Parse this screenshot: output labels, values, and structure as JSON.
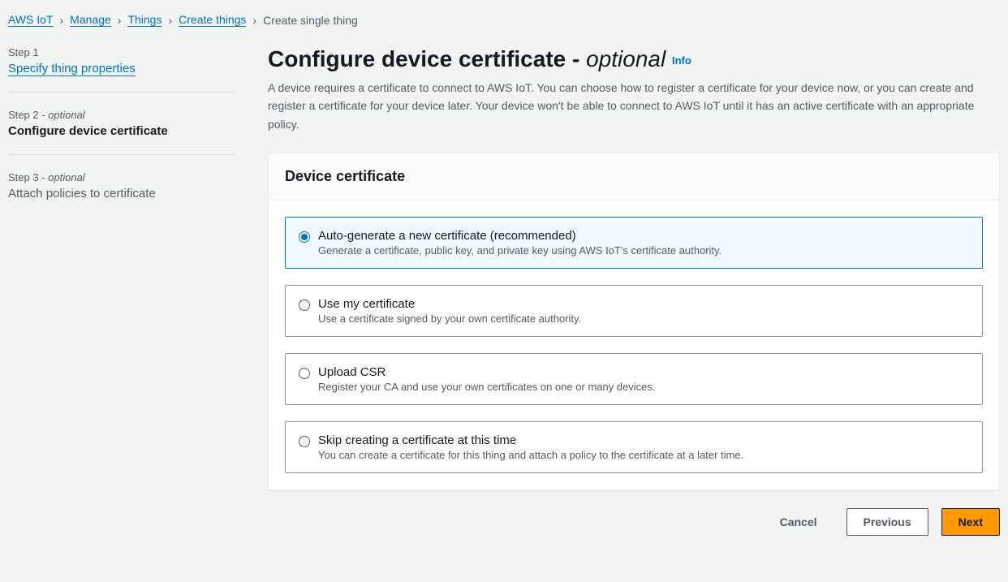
{
  "breadcrumb": {
    "items": [
      {
        "label": "AWS IoT",
        "link": true
      },
      {
        "label": "Manage",
        "link": true
      },
      {
        "label": "Things",
        "link": true
      },
      {
        "label": "Create things",
        "link": true
      },
      {
        "label": "Create single thing",
        "link": false
      }
    ]
  },
  "steps": [
    {
      "label": "Step 1",
      "optional": "",
      "title": "Specify thing properties",
      "state": "link"
    },
    {
      "label": "Step 2",
      "optional": " - optional",
      "title": "Configure device certificate",
      "state": "active"
    },
    {
      "label": "Step 3",
      "optional": " - optional",
      "title": "Attach policies to certificate",
      "state": "future"
    }
  ],
  "page": {
    "title_main": "Configure device certificate",
    "title_sep": " - ",
    "title_optional": "optional",
    "info": "Info",
    "description": "A device requires a certificate to connect to AWS IoT. You can choose how to register a certificate for your device now, or you can create and register a certificate for your device later. Your device won't be able to connect to AWS IoT until it has an active certificate with an appropriate policy."
  },
  "panel": {
    "header": "Device certificate",
    "options": [
      {
        "title": "Auto-generate a new certificate (recommended)",
        "desc": "Generate a certificate, public key, and private key using AWS IoT's certificate authority.",
        "selected": true
      },
      {
        "title": "Use my certificate",
        "desc": "Use a certificate signed by your own certificate authority.",
        "selected": false
      },
      {
        "title": "Upload CSR",
        "desc": "Register your CA and use your own certificates on one or many devices.",
        "selected": false
      },
      {
        "title": "Skip creating a certificate at this time",
        "desc": "You can create a certificate for this thing and attach a policy to the certificate at a later time.",
        "selected": false
      }
    ]
  },
  "footer": {
    "cancel": "Cancel",
    "previous": "Previous",
    "next": "Next"
  }
}
